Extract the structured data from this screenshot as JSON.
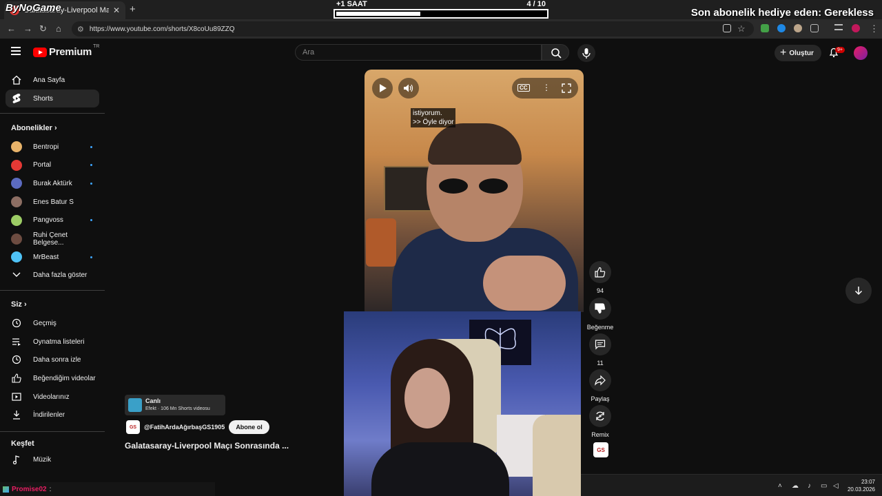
{
  "browser": {
    "tab_title": "Galatasaray-Liverpool Maçı",
    "overlay_logo": "ByNoGame",
    "url": "https://www.youtube.com/shorts/X8coUu89ZZQ",
    "close_glyph": "✕",
    "newtab_glyph": "+"
  },
  "stream_overlay": {
    "timer_label": "+1 SAAT",
    "timer_count": "4  / 10",
    "timer_progress": 0.4,
    "gift_text": "Son abonelik hediye eden: Gerekless"
  },
  "header": {
    "logo_text": "Premium",
    "country": "TR",
    "search_placeholder": "Ara",
    "create_label": "Oluştur",
    "notif_badge": "9+"
  },
  "sidebar": {
    "home": "Ana Sayfa",
    "shorts": "Shorts",
    "subs_heading": "Abonelikler",
    "channels": [
      {
        "name": "Bentropi",
        "color": "#e8b36a",
        "dot": true
      },
      {
        "name": "Portal",
        "color": "#e53935",
        "dot": true
      },
      {
        "name": "Burak Aktürk",
        "color": "#5c6bc0",
        "dot": true
      },
      {
        "name": "Enes Batur S",
        "color": "#8d6e63",
        "dot": false
      },
      {
        "name": "Pangvoss",
        "color": "#9ccc65",
        "dot": true
      },
      {
        "name": "Ruhi Çenet Belgese...",
        "color": "#6d4c41",
        "dot": false
      },
      {
        "name": "MrBeast",
        "color": "#4fc3f7",
        "dot": true
      }
    ],
    "show_more": "Daha fazla göster",
    "you_heading": "Siz",
    "you_items": [
      "Geçmiş",
      "Oynatma listeleri",
      "Daha sonra izle",
      "Beğendiğim videolar",
      "Videolarınız",
      "İndirilenler"
    ],
    "explore_heading": "Keşfet",
    "music": "Müzik"
  },
  "short": {
    "caption_line1": "istiyorum.",
    "caption_line2": ">> Öyle diyor",
    "cc_label": "CC"
  },
  "actions": {
    "likes": "94",
    "dislike_label": "Beğenme",
    "comments": "11",
    "share_label": "Paylaş",
    "remix_label": "Remix"
  },
  "info": {
    "effect_title": "Canlı",
    "effect_sub": "Efekt · 106 Mn Shorts videosu",
    "channel": "@FatihArdaAğırbaşGS1905",
    "channel_badge": "GS",
    "subscribe": "Abone ol",
    "title": "Galatasaray-Liverpool Maçı Sonrasında ..."
  },
  "chat": {
    "user": "Promise02",
    "sep": ":"
  },
  "taskbar": {
    "time": "23:07",
    "date": "20.03.2026"
  }
}
